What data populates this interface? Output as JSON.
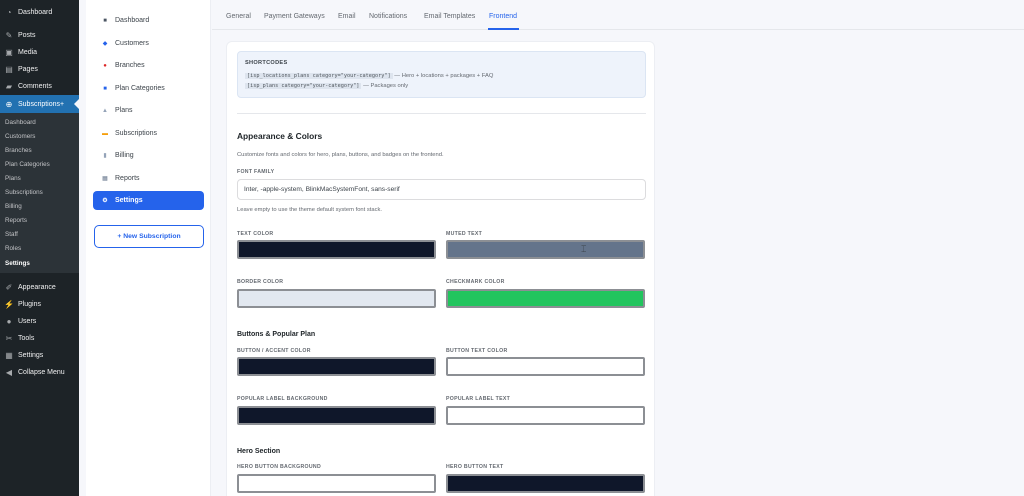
{
  "wp_menu": {
    "top": [
      {
        "label": "Dashboard",
        "icon": "dashboard-icon",
        "glyph": "◔"
      },
      {
        "label": "Posts",
        "icon": "pin-icon",
        "glyph": "✎"
      },
      {
        "label": "Media",
        "icon": "media-icon",
        "glyph": "▣"
      },
      {
        "label": "Pages",
        "icon": "pages-icon",
        "glyph": "▤"
      },
      {
        "label": "Comments",
        "icon": "comment-icon",
        "glyph": "▰"
      },
      {
        "label": "Subscriptions+",
        "icon": "subscriptions-icon",
        "glyph": "⊕"
      }
    ],
    "submenu": [
      "Dashboard",
      "Customers",
      "Branches",
      "Plan Categories",
      "Plans",
      "Subscriptions",
      "Billing",
      "Reports",
      "Staff",
      "Roles",
      "Settings"
    ],
    "bottom": [
      {
        "label": "Appearance",
        "icon": "appearance-icon",
        "glyph": "✐"
      },
      {
        "label": "Plugins",
        "icon": "plugin-icon",
        "glyph": "⚡"
      },
      {
        "label": "Users",
        "icon": "users-icon",
        "glyph": "●"
      },
      {
        "label": "Tools",
        "icon": "tools-icon",
        "glyph": "✂"
      },
      {
        "label": "Settings",
        "icon": "settings-icon",
        "glyph": "▦"
      },
      {
        "label": "Collapse Menu",
        "icon": "collapse-icon",
        "glyph": "◀"
      }
    ]
  },
  "plugin_nav": {
    "items": [
      {
        "label": "Dashboard",
        "icon": "dashboard-icon",
        "glyph": "■",
        "color": "#4b5563"
      },
      {
        "label": "Customers",
        "icon": "customers-icon",
        "glyph": "◆",
        "color": "#2563eb"
      },
      {
        "label": "Branches",
        "icon": "location-pin-icon",
        "glyph": "●",
        "color": "#dc2626"
      },
      {
        "label": "Plan Categories",
        "icon": "folder-icon",
        "glyph": "■",
        "color": "#2563eb"
      },
      {
        "label": "Plans",
        "icon": "plans-icon",
        "glyph": "▲",
        "color": "#94a3b8"
      },
      {
        "label": "Subscriptions",
        "icon": "subscriptions-icon",
        "glyph": "▬",
        "color": "#f59e0b"
      },
      {
        "label": "Billing",
        "icon": "billing-icon",
        "glyph": "▮",
        "color": "#94a3b8"
      },
      {
        "label": "Reports",
        "icon": "reports-icon",
        "glyph": "▦",
        "color": "#64748b"
      },
      {
        "label": "Settings",
        "icon": "gear-icon",
        "glyph": "⚙",
        "color": "#ffffff"
      }
    ],
    "new_button": "+ New Subscription"
  },
  "tabs": [
    "General",
    "Payment Gateways",
    "Email",
    "Notifications",
    "Email Templates",
    "Frontend"
  ],
  "active_tab": "Frontend",
  "shortcodes": {
    "title": "SHORTCODES",
    "line1_code": "[isp_locations_plans category=\"your-category\"]",
    "line1_desc": "— Hero + locations + packages + FAQ",
    "line2_code": "[isp_plans category=\"your-category\"]",
    "line2_desc": "— Packages only"
  },
  "appearance": {
    "title": "Appearance & Colors",
    "description": "Customize fonts and colors for hero, plans, buttons, and badges on the frontend.",
    "font_family_label": "FONT FAMILY",
    "font_family_value": "Inter, -apple-system, BlinkMacSystemFont, sans-serif",
    "font_hint": "Leave empty to use the theme default system font stack.",
    "text_color_label": "TEXT COLOR",
    "text_color": "#0f172a",
    "muted_text_label": "MUTED TEXT",
    "muted_text": "#64748b",
    "border_color_label": "BORDER COLOR",
    "border_color": "#e2e8f0",
    "checkmark_color_label": "CHECKMARK COLOR",
    "checkmark_color": "#22c55e"
  },
  "buttons": {
    "title": "Buttons & Popular Plan",
    "accent_label": "BUTTON / ACCENT COLOR",
    "accent_color": "#0f172a",
    "button_text_label": "BUTTON TEXT COLOR",
    "button_text_color": "#ffffff",
    "popular_bg_label": "POPULAR LABEL BACKGROUND",
    "popular_bg_color": "#0f172a",
    "popular_text_label": "POPULAR LABEL TEXT",
    "popular_text_color": "#ffffff"
  },
  "hero": {
    "title": "Hero Section",
    "button_bg_label": "HERO BUTTON BACKGROUND",
    "button_bg_color": "#ffffff",
    "button_text_label": "HERO BUTTON TEXT",
    "button_text_color": "#0f172a"
  }
}
